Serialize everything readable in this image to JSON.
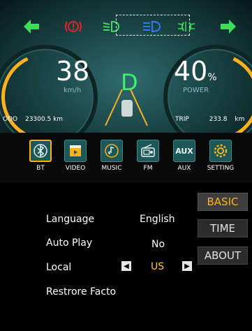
{
  "colors": {
    "accent": "#ffb21e",
    "green": "#3ddc5a",
    "alert": "#e0242a",
    "beam": "#2e7bff"
  },
  "icons": {
    "left_arrow": "left-arrow-icon",
    "brake_warning": "brake-warning-icon",
    "low_beam": "low-beam-icon",
    "high_beam": "high-beam-icon",
    "fog_light": "fog-light-icon",
    "right_arrow": "right-arrow-icon"
  },
  "speed": {
    "value": "38",
    "unit": "km/h"
  },
  "gear": "D",
  "power": {
    "value": "40",
    "percent": "%",
    "label": "POWER"
  },
  "odo": {
    "label": "ODO",
    "value": "23300.5 km"
  },
  "trip": {
    "label": "TRIP",
    "value": "233.8",
    "unit": "km"
  },
  "media": [
    {
      "label": "BT",
      "icon": "bluetooth-icon",
      "glyph": "ʙ"
    },
    {
      "label": "VIDEO",
      "icon": "video-icon",
      "glyph": "▶"
    },
    {
      "label": "MUSIC",
      "icon": "music-icon",
      "glyph": "♪"
    },
    {
      "label": "FM",
      "icon": "radio-icon",
      "glyph": "▤"
    },
    {
      "label": "AUX",
      "icon": "aux-icon",
      "glyph": "AUX"
    },
    {
      "label": "SETTING",
      "icon": "settings-gear-icon",
      "glyph": "⚙"
    }
  ],
  "settings": {
    "language_label": "Language",
    "language_value": "English",
    "autoplay_label": "Auto Play",
    "autoplay_value": "No",
    "local_label": "Local",
    "local_value": "US",
    "restore_label": "Restrore Facto"
  },
  "tabs": {
    "basic": "BASIC",
    "time": "TIME",
    "about": "ABOUT"
  }
}
